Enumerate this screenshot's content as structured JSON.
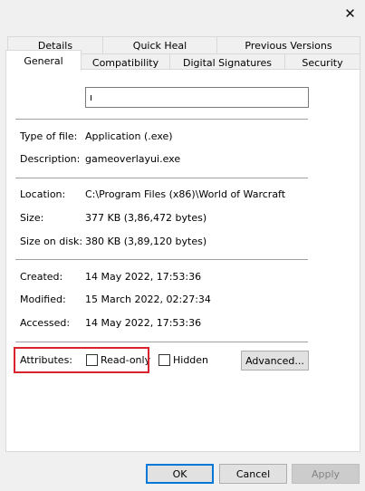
{
  "window": {
    "close_glyph": "✕"
  },
  "tabs_row1": [
    "Details",
    "Quick Heal",
    "Previous Versions"
  ],
  "tabs_row2": [
    "General",
    "Compatibility",
    "Digital Signatures",
    "Security"
  ],
  "name_field": {
    "value": "ı"
  },
  "file_info": {
    "type_label": "Type of file:",
    "type_value": "Application (.exe)",
    "description_label": "Description:",
    "description_value": "gameoverlayui.exe",
    "location_label": "Location:",
    "location_value": "C:\\Program Files (x86)\\World of Warcraft",
    "size_label": "Size:",
    "size_value": "377 KB (3,86,472 bytes)",
    "size_on_disk_label": "Size on disk:",
    "size_on_disk_value": "380 KB (3,89,120 bytes)",
    "created_label": "Created:",
    "created_value": "14 May 2022, 17:53:36",
    "modified_label": "Modified:",
    "modified_value": "15 March 2022, 02:27:34",
    "accessed_label": "Accessed:",
    "accessed_value": "14 May 2022, 17:53:36"
  },
  "attributes": {
    "label": "Attributes:",
    "readonly_label": "Read-only",
    "readonly_checked": false,
    "hidden_label": "Hidden",
    "hidden_checked": false,
    "advanced_label": "Advanced..."
  },
  "footer": {
    "ok_label": "OK",
    "cancel_label": "Cancel",
    "apply_label": "Apply"
  },
  "colors": {
    "highlight": "#d9232d",
    "default_button_border": "#0078d7"
  }
}
